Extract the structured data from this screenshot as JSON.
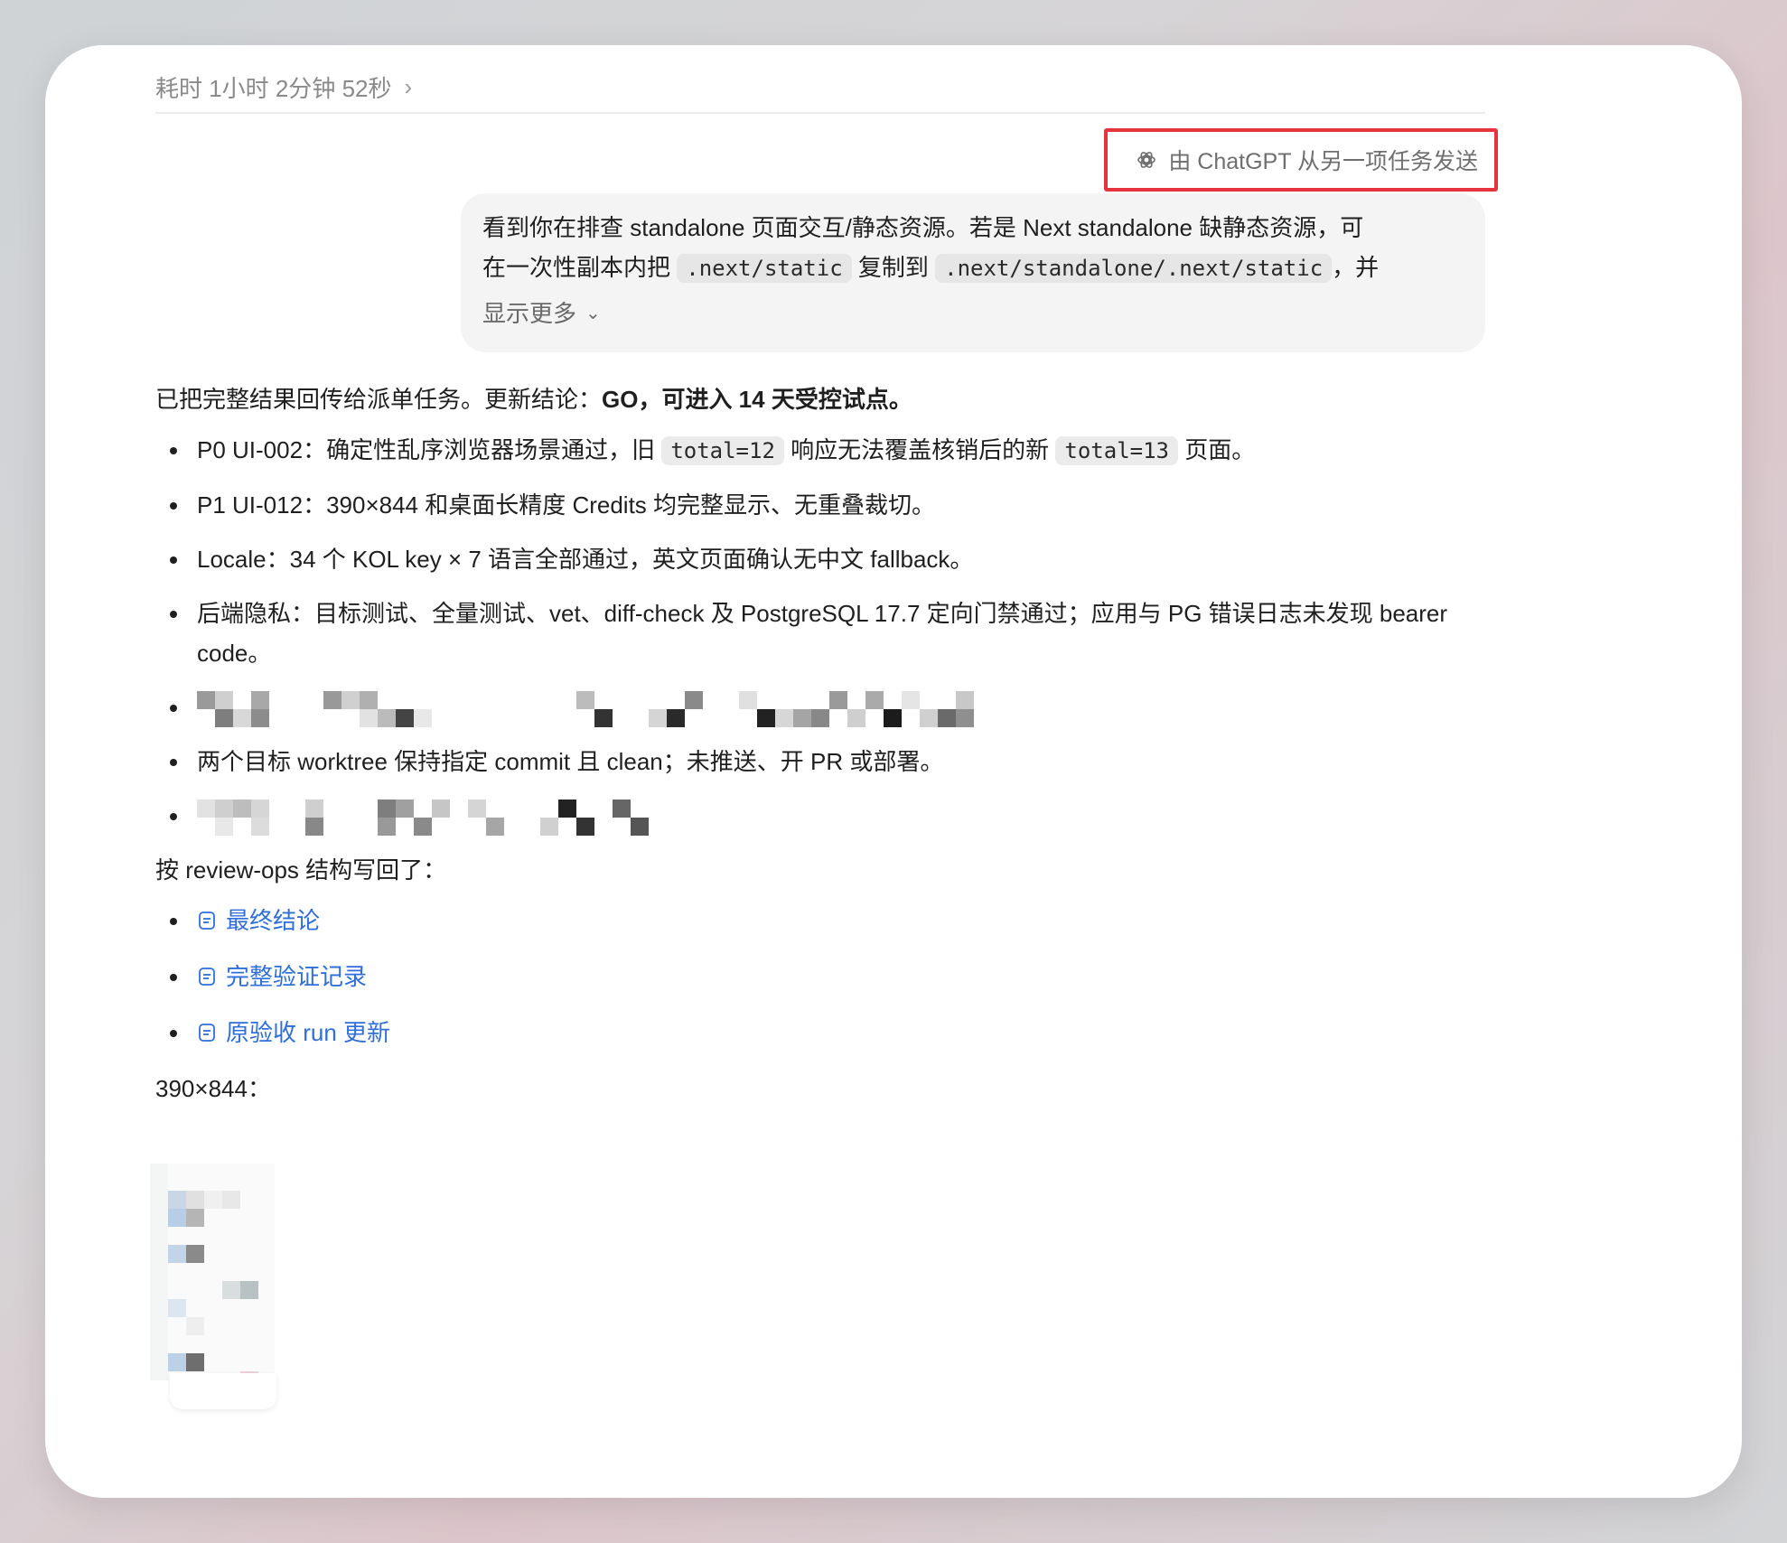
{
  "thread": {
    "duration_label": "耗时 1小时 2分钟 52秒",
    "sender_label": "由 ChatGPT 从另一项任务发送"
  },
  "bubble": {
    "line1": "看到你在排查 standalone 页面交互/静态资源。若是 Next standalone 缺静态资源，可",
    "line2_a": "在一次性副本内把",
    "code1": ".next/static",
    "line2_b": "复制到",
    "code2": ".next/standalone/.next/static",
    "line2_c": "，并",
    "show_more": "显示更多"
  },
  "reply": {
    "intro_a": "已把完整结果回传给派单任务。更新结论：",
    "intro_bold": "GO，可进入 14 天受控试点。",
    "bullets": [
      {
        "a": "P0 UI-002：确定性乱序浏览器场景通过，旧",
        "code1": "total=12",
        "b": "响应无法覆盖核销后的新",
        "code2": "total=13",
        "c": "页面。"
      },
      {
        "text": "P1 UI-012：390×844 和桌面长精度 Credits 均完整显示、无重叠裁切。"
      },
      {
        "text": "Locale：34 个 KOL key × 7 语言全部通过，英文页面确认无中文 fallback。"
      },
      {
        "text": "后端隐私：目标测试、全量测试、vet、diff-check 及 PostgreSQL 17.7 定向门禁通过；应用与 PG 错误日志未发现 bearer code。"
      },
      {
        "text": "两个目标 worktree 保持指定 commit 且 clean；未推送、开 PR 或部署。"
      }
    ],
    "review_intro": "按 review-ops 结构写回了：",
    "links": [
      "最终结论",
      "完整验证记录",
      "原验收 run 更新"
    ],
    "screenshot_label": "390×844："
  }
}
